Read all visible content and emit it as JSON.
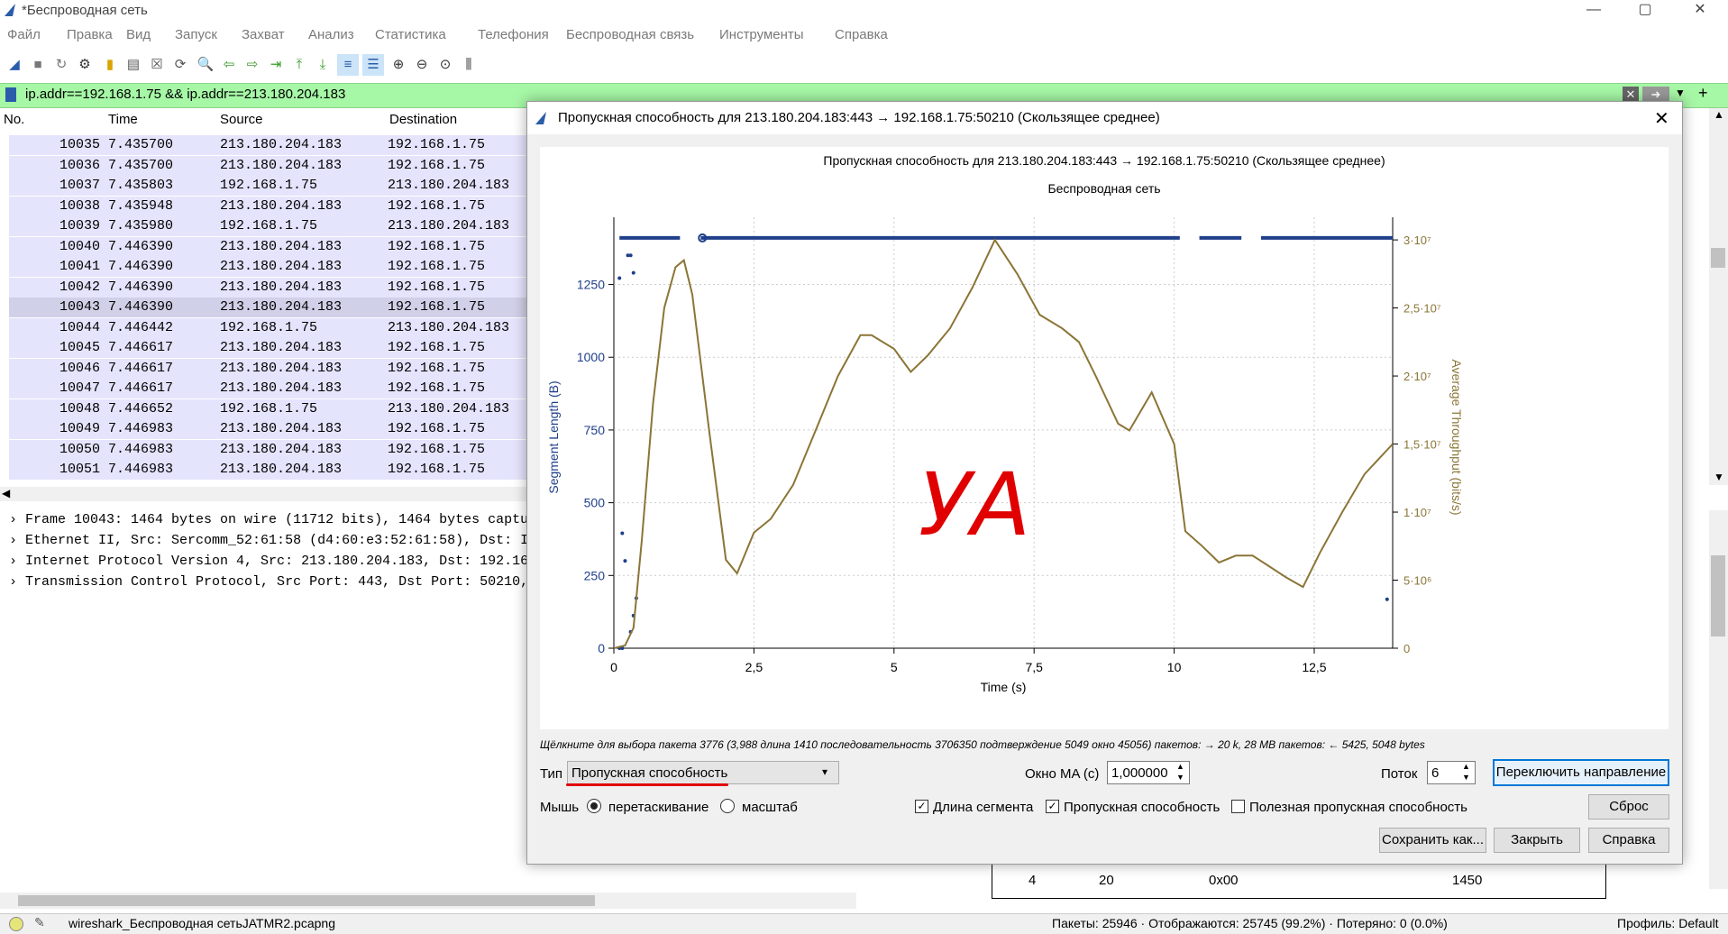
{
  "window": {
    "title": "*Беспроводная сеть"
  },
  "menu": [
    "Файл",
    "Правка",
    "Вид",
    "Запуск",
    "Захват",
    "Анализ",
    "Статистика",
    "Телефония",
    "Беспроводная связь",
    "Инструменты",
    "Справка"
  ],
  "filter": {
    "text": "ip.addr==192.168.1.75 && ip.addr==213.180.204.183"
  },
  "packet_list": {
    "headers": [
      "No.",
      "Time",
      "Source",
      "Destination"
    ],
    "rows": [
      [
        "10035",
        "7.435700",
        "213.180.204.183",
        "192.168.1.75"
      ],
      [
        "10036",
        "7.435700",
        "213.180.204.183",
        "192.168.1.75"
      ],
      [
        "10037",
        "7.435803",
        "192.168.1.75",
        "213.180.204.183"
      ],
      [
        "10038",
        "7.435948",
        "213.180.204.183",
        "192.168.1.75"
      ],
      [
        "10039",
        "7.435980",
        "192.168.1.75",
        "213.180.204.183"
      ],
      [
        "10040",
        "7.446390",
        "213.180.204.183",
        "192.168.1.75"
      ],
      [
        "10041",
        "7.446390",
        "213.180.204.183",
        "192.168.1.75"
      ],
      [
        "10042",
        "7.446390",
        "213.180.204.183",
        "192.168.1.75"
      ],
      [
        "10043",
        "7.446390",
        "213.180.204.183",
        "192.168.1.75"
      ],
      [
        "10044",
        "7.446442",
        "192.168.1.75",
        "213.180.204.183"
      ],
      [
        "10045",
        "7.446617",
        "213.180.204.183",
        "192.168.1.75"
      ],
      [
        "10046",
        "7.446617",
        "213.180.204.183",
        "192.168.1.75"
      ],
      [
        "10047",
        "7.446617",
        "213.180.204.183",
        "192.168.1.75"
      ],
      [
        "10048",
        "7.446652",
        "192.168.1.75",
        "213.180.204.183"
      ],
      [
        "10049",
        "7.446983",
        "213.180.204.183",
        "192.168.1.75"
      ],
      [
        "10050",
        "7.446983",
        "213.180.204.183",
        "192.168.1.75"
      ],
      [
        "10051",
        "7.446983",
        "213.180.204.183",
        "192.168.1.75"
      ]
    ]
  },
  "details": [
    "Frame 10043: 1464 bytes on wire (11712 bits), 1464 bytes captu",
    "Ethernet II, Src: Sercomm_52:61:58 (d4:60:e3:52:61:58), Dst: In",
    "Internet Protocol Version 4, Src: 213.180.204.183, Dst: 192.168",
    "Transmission Control Protocol, Src Port: 443, Dst Port: 50210,"
  ],
  "bytes_table": {
    "c1": "4",
    "c2": "20",
    "c3": "0x00",
    "c4": "1450"
  },
  "dialog": {
    "title": "Пропускная способность для 213.180.204.183:443 → 192.168.1.75:50210 (Скользящее среднее)",
    "plot_title": "Пропускная способность для 213.180.204.183:443 → 192.168.1.75:50210 (Скользящее среднее)",
    "plot_subtitle": "Беспроводная сеть",
    "hint": "Щёлкните для выбора пакета 3776 (3,988 длина 1410 последовательность 3706350 подтверждение 5049 окно 45056) пакетов: → 20 k, 28 MB пакетов: ← 5425, 5048 bytes",
    "type_label": "Тип",
    "type_value": "Пропускная способность",
    "ma_label": "Окно MA (с)",
    "ma_value": "1,000000",
    "stream_label": "Поток",
    "stream_value": "6",
    "switch_btn": "Переключить направление",
    "mouse_label": "Мышь",
    "drag_label": "перетаскивание",
    "zoom_label": "масштаб",
    "seg_label": "Длина сегмента",
    "thr_label": "Пропускная способность",
    "goodput_label": "Полезная пропускная способность",
    "reset_btn": "Сброс",
    "save_btn": "Сохранить как...",
    "close_btn": "Закрыть",
    "help_btn": "Справка",
    "annotation": "УА"
  },
  "chart_data": {
    "type": "line",
    "title": "Пропускная способность для 213.180.204.183:443 → 192.168.1.75:50210 (Скользящее среднее)",
    "subtitle": "Беспроводная сеть",
    "xlabel": "Time (s)",
    "ylabel_left": "Segment Length (B)",
    "ylabel_right": "Average Throughput (bits/s)",
    "xlim": [
      0,
      13.9
    ],
    "ylim_left": [
      0,
      1450
    ],
    "ylim_right": [
      0,
      31000000
    ],
    "x_ticks": [
      "0",
      "2,5",
      "5",
      "7,5",
      "10",
      "12,5"
    ],
    "y_ticks_left": [
      "0",
      "250",
      "500",
      "750",
      "1000",
      "1250"
    ],
    "y_ticks_right": [
      "0",
      "5·10⁶",
      "1·10⁷",
      "1,5·10⁷",
      "2·10⁷",
      "2,5·10⁷",
      "3·10⁷"
    ],
    "grid": true,
    "series": [
      {
        "name": "Segment Length",
        "color": "#1f3f8a",
        "kind": "scatter",
        "x": [
          0.1,
          0.15,
          0.2,
          0.25,
          0.3,
          0.35,
          0.1,
          0.15,
          0.3,
          0.35,
          0.4,
          13.8
        ],
        "y": [
          1272,
          395,
          300,
          1350,
          1350,
          1290,
          0,
          0,
          56,
          112,
          172,
          168
        ]
      },
      {
        "name": "Average Throughput",
        "color": "#8b7536",
        "kind": "line",
        "x": [
          0,
          0.2,
          0.35,
          0.5,
          0.7,
          0.9,
          1.1,
          1.25,
          1.4,
          1.7,
          2.0,
          2.2,
          2.5,
          2.8,
          3.2,
          3.6,
          4.0,
          4.4,
          4.6,
          5.0,
          5.3,
          5.6,
          6.0,
          6.4,
          6.8,
          7.2,
          7.6,
          8.0,
          8.3,
          8.6,
          9.0,
          9.2,
          9.6,
          10.0,
          10.2,
          10.5,
          10.8,
          11.1,
          11.4,
          11.7,
          12.0,
          12.3,
          12.6,
          13.0,
          13.4,
          13.9
        ],
        "y": [
          0,
          200000,
          1500000,
          8000000,
          18000000,
          25000000,
          28000000,
          28500000,
          26000000,
          16000000,
          6500000,
          5500000,
          8500000,
          9500000,
          12000000,
          16000000,
          20000000,
          23000000,
          23000000,
          22000000,
          20300000,
          21500000,
          23500000,
          26500000,
          30000000,
          27500000,
          24500000,
          23500000,
          22500000,
          20000000,
          16500000,
          16000000,
          18800000,
          15000000,
          8600000,
          7500000,
          6300000,
          6800000,
          6800000,
          6000000,
          5200000,
          4500000,
          7000000,
          10000000,
          12800000,
          15000000
        ]
      }
    ]
  },
  "status": {
    "file": "wireshark_Беспроводная сетьJATMR2.pcapng",
    "packets": "Пакеты: 25946 · Отображаются: 25745 (99.2%) · Потеряно: 0 (0.0%)",
    "profile": "Профиль: Default"
  }
}
